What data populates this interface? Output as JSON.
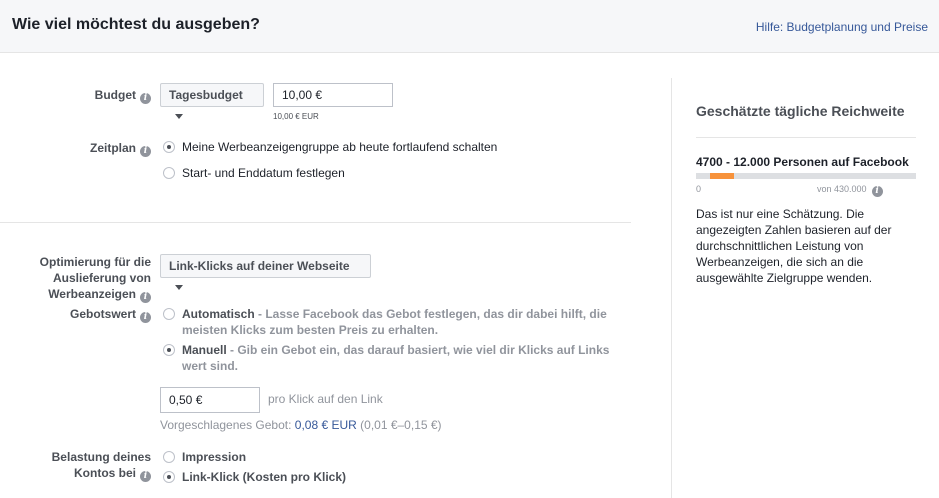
{
  "header": {
    "title": "Wie viel möchtest du ausgeben?",
    "help_link": "Hilfe: Budgetplanung und Preise"
  },
  "budget": {
    "label": "Budget",
    "type_selected": "Tagesbudget",
    "amount_value": "10,00 €",
    "amount_note": "10,00 € EUR"
  },
  "schedule": {
    "label": "Zeitplan",
    "options": [
      {
        "label": "Meine Werbeanzeigengruppe ab heute fortlaufend schalten",
        "checked": true
      },
      {
        "label": "Start- und Enddatum festlegen",
        "checked": false
      }
    ]
  },
  "optimization": {
    "label_line1": "Optimierung für die",
    "label_line2": "Auslieferung von",
    "label_line3": "Werbeanzeigen",
    "selected": "Link-Klicks auf deiner Webseite"
  },
  "bid": {
    "label": "Gebotswert",
    "auto_title": "Automatisch",
    "auto_desc_line1": " - Lasse Facebook das Gebot festlegen, das dir dabei hilft, die",
    "auto_desc_line2": "meisten Klicks zum besten Preis zu erhalten.",
    "manual_title": "Manuell",
    "manual_desc_line1": " - Gib ein Gebot ein, das darauf basiert, wie viel dir Klicks auf Links",
    "manual_desc_line2": "wert sind.",
    "auto_checked": false,
    "manual_checked": true,
    "amount_value": "0,50 €",
    "amount_suffix": "pro Klick auf den Link",
    "suggested_prefix": "Vorgeschlagenes Gebot: ",
    "suggested_value": "0,08 € EUR",
    "suggested_range": " (0,01 €–0,15 €)"
  },
  "charge": {
    "label_line1": "Belastung deines",
    "label_line2": "Kontos bei",
    "options": [
      {
        "label": "Impression",
        "checked": false
      },
      {
        "label": "Link-Klick (Kosten pro Klick)",
        "checked": true
      }
    ]
  },
  "reach": {
    "title": "Geschätzte tägliche Reichweite",
    "range_text": "4700 - 12.000 Personen auf Facebook",
    "bar_start_fraction": 0.011,
    "bar_end_fraction": 0.028,
    "min_label": "0",
    "max_label": "von 430.000",
    "description": "Das ist nur eine Schätzung. Die angezeigten Zahlen basieren auf der durchschnittlichen Leistung von Werbeanzeigen, die sich an die ausgewählte Zielgruppe wenden.",
    "bar_color": "#f7923b"
  },
  "colors": {
    "link": "#365899",
    "accent": "#f7923b"
  }
}
